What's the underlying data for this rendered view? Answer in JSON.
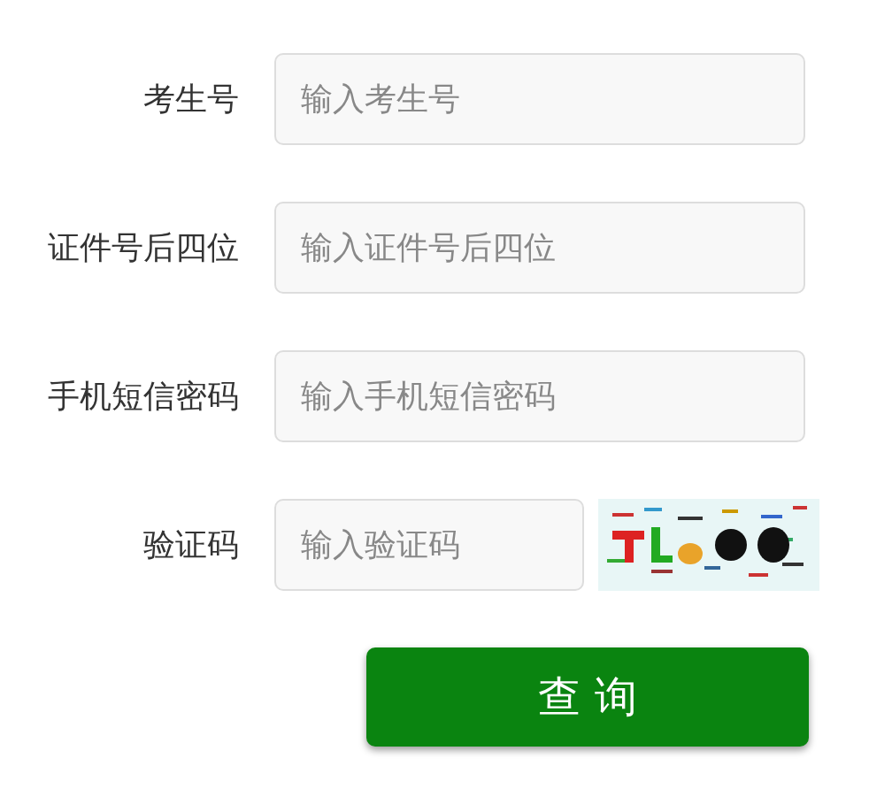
{
  "fields": [
    {
      "kind": "text",
      "label": "考生号",
      "placeholder": "输入考生号"
    },
    {
      "kind": "text",
      "label": "证件号后四位",
      "placeholder": "输入证件号后四位"
    },
    {
      "kind": "text",
      "label": "手机短信密码",
      "placeholder": "输入手机短信密码"
    },
    {
      "kind": "captcha",
      "label": "验证码",
      "placeholder": "输入验证码"
    }
  ],
  "submit_button": "查 询"
}
